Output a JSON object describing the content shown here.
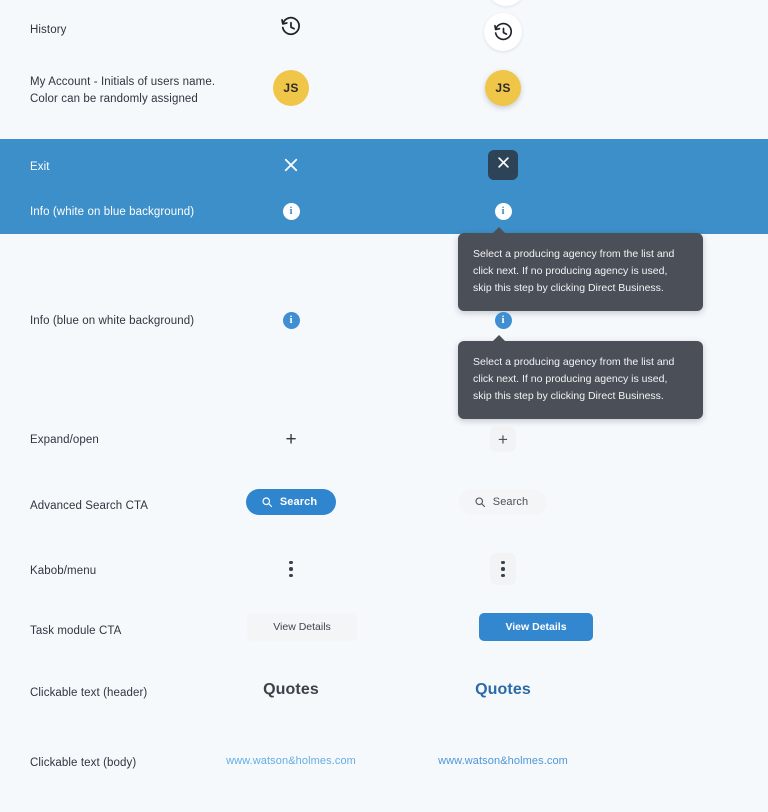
{
  "page": {
    "background_color": "#f6f9fc",
    "band_color": "#3d8fc9",
    "accent_blue": "#2f86cf",
    "avatar_color": "#f0c648",
    "tooltip_bg": "#4b4f57"
  },
  "rows": [
    {
      "id": "history",
      "label": "History",
      "default_state": "history-icon",
      "hover_state": "history-icon-on-white-circle"
    },
    {
      "id": "my-account",
      "label": "My Account - Initials of users name.\nColor can be randomly assigned",
      "avatar_initials": "JS"
    },
    {
      "id": "exit",
      "label": "Exit",
      "default_state": "close-icon",
      "hover_state": "close-icon-in-dark-box"
    },
    {
      "id": "info-white-on-blue",
      "label": "Info (white on blue background)",
      "tooltip": "Select a producing agency from the list and click next. If no producing agency is used, skip this step by clicking Direct Business."
    },
    {
      "id": "info-blue-on-white",
      "label": "Info (blue on white background)",
      "tooltip": "Select a producing agency from the list and click next. If no producing agency is used, skip this step by clicking Direct Business."
    },
    {
      "id": "expand-open",
      "label": "Expand/open",
      "glyph": "+"
    },
    {
      "id": "advanced-search-cta",
      "label": "Advanced Search CTA",
      "button_label": "Search"
    },
    {
      "id": "kabob-menu",
      "label": "Kabob/menu"
    },
    {
      "id": "task-module-cta",
      "label": "Task module CTA",
      "button_label": "View Details"
    },
    {
      "id": "clickable-text-header",
      "label": "Clickable text (header)",
      "text": "Quotes"
    },
    {
      "id": "clickable-text-body",
      "label": "Clickable text (body)",
      "text": "www.watson&holmes.com"
    }
  ]
}
